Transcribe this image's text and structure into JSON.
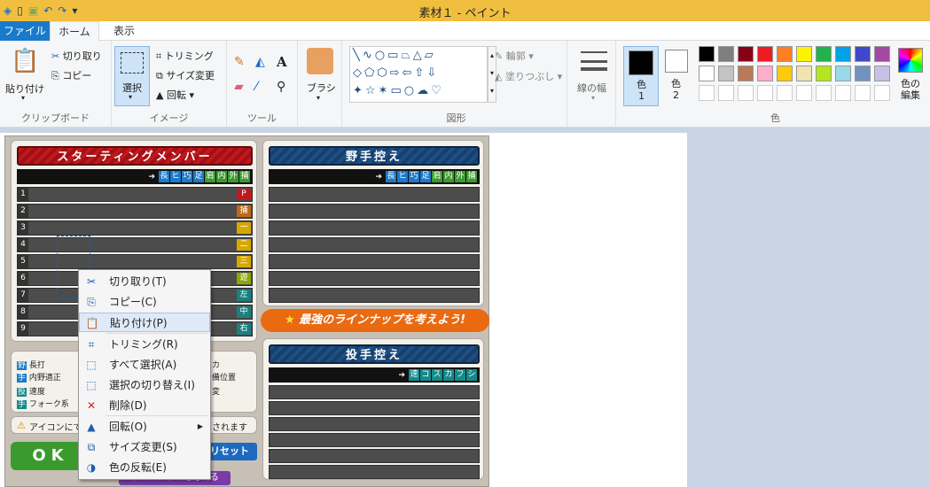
{
  "window": {
    "title": "素材１ - ペイント"
  },
  "tabs": [
    {
      "label": "ファイル"
    },
    {
      "label": "ホーム"
    },
    {
      "label": "表示"
    }
  ],
  "ribbon": {
    "clipboard": {
      "paste": "貼り付け",
      "cut": "切り取り",
      "copy": "コピー",
      "label": "クリップボード"
    },
    "image": {
      "select": "選択",
      "crop": "トリミング",
      "resize": "サイズ変更",
      "rotate": "回転",
      "label": "イメージ"
    },
    "tools": {
      "label": "ツール"
    },
    "brush": {
      "label": "ブラシ"
    },
    "shapes": {
      "outline": "輪郭",
      "fill": "塗りつぶし",
      "label": "図形"
    },
    "size": {
      "label": "線の幅"
    },
    "colors": {
      "color1": "色\n1",
      "color2": "色\n2",
      "edit": "色の\n編集",
      "label": "色",
      "palette": [
        "#000000",
        "#7f7f7f",
        "#880015",
        "#ed1c24",
        "#ff7f27",
        "#fff200",
        "#22b14c",
        "#00a2e8",
        "#3f48cc",
        "#a349a4",
        "#ffffff",
        "#c3c3c3",
        "#b97a57",
        "#ffaec9",
        "#ffc90e",
        "#efe4b0",
        "#b5e61d",
        "#99d9ea",
        "#7092be",
        "#c8bfe7"
      ]
    }
  },
  "game": {
    "starting": {
      "title": "スターティングメンバー",
      "stats": [
        "長",
        "ヒ",
        "巧",
        "足",
        "肩",
        "内",
        "外",
        "捕"
      ],
      "rows": [
        {
          "num": "1",
          "pos": "P",
          "color": "#c0181c"
        },
        {
          "num": "2",
          "pos": "捕",
          "color": "#c06818"
        },
        {
          "num": "3",
          "pos": "一",
          "color": "#d6a800"
        },
        {
          "num": "4",
          "pos": "二",
          "color": "#d6a800"
        },
        {
          "num": "5",
          "pos": "三",
          "color": "#d6a800"
        },
        {
          "num": "6",
          "pos": "遊",
          "color": "#8aa800"
        },
        {
          "num": "7",
          "pos": "左",
          "color": "#1a8080"
        },
        {
          "num": "8",
          "pos": "中",
          "color": "#1a8080"
        },
        {
          "num": "9",
          "pos": "右",
          "color": "#1a8080"
        }
      ]
    },
    "fielders": {
      "title": "野手控え",
      "stats": [
        "長",
        "ヒ",
        "巧",
        "足",
        "肩",
        "内",
        "外",
        "捕"
      ]
    },
    "banner": "最強のラインナップを考えよう!",
    "pitchers": {
      "title": "投手控え",
      "stats": [
        "速",
        "コ",
        "ス",
        "カ",
        "フ",
        "シ"
      ]
    },
    "legend": [
      "野",
      "手",
      "長打",
      "内野適正",
      "投",
      "手",
      "速度",
      "フォーク系",
      "カ",
      "備位置",
      "変"
    ],
    "notice": "アイコンにて",
    "notice2": "されます",
    "ok": "OK",
    "reset": "リセット",
    "bottom": "ラインナップを考える"
  },
  "context_menu": [
    {
      "label": "切り取り(T)",
      "icon": "scissors-icon",
      "glyph": "✂"
    },
    {
      "label": "コピー(C)",
      "icon": "copy-icon",
      "glyph": "⎘"
    },
    {
      "label": "貼り付け(P)",
      "icon": "paste-icon",
      "glyph": "📋",
      "highlight": true
    },
    {
      "label": "トリミング(R)",
      "icon": "crop-icon",
      "glyph": "⌗"
    },
    {
      "label": "すべて選択(A)",
      "icon": "select-all-icon",
      "glyph": "⬚"
    },
    {
      "label": "選択の切り替え(I)",
      "icon": "invert-selection-icon",
      "glyph": "⬚"
    },
    {
      "label": "削除(D)",
      "icon": "delete-icon",
      "glyph": "✕"
    },
    {
      "label": "回転(O)",
      "icon": "rotate-icon",
      "glyph": "▲"
    },
    {
      "label": "サイズ変更(S)",
      "icon": "resize-icon",
      "glyph": "⧉"
    },
    {
      "label": "色の反転(E)",
      "icon": "invert-color-icon",
      "glyph": "◑"
    }
  ]
}
